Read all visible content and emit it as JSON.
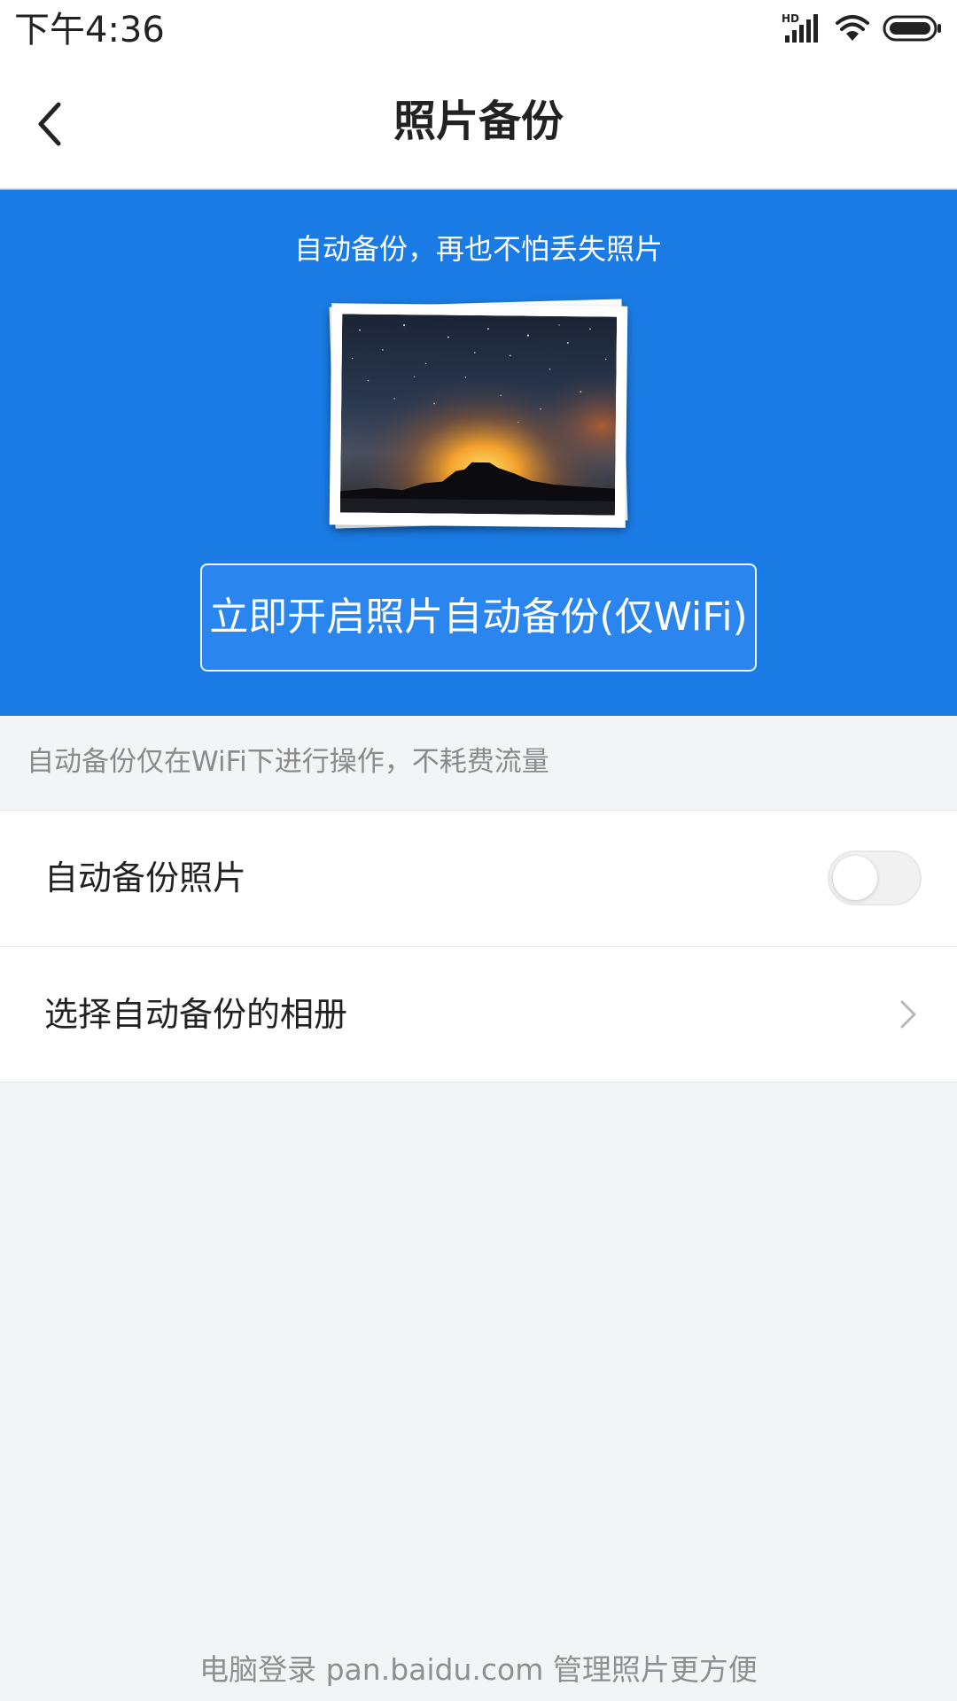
{
  "status_bar": {
    "time": "下午4:36",
    "icons": [
      "hd-signal-icon",
      "wifi-icon",
      "battery-icon"
    ]
  },
  "header": {
    "title": "照片备份",
    "back_icon": "chevron-left-icon"
  },
  "banner": {
    "tagline": "自动备份，再也不怕丢失照片",
    "image": "starry-night-photo",
    "enable_button_label": "立即开启照片自动备份(仅WiFi)",
    "background_color": "#1b7be4"
  },
  "notice": {
    "text": "自动备份仅在WiFi下进行操作，不耗费流量"
  },
  "settings": {
    "items": [
      {
        "label": "自动备份照片",
        "control": "toggle",
        "enabled": false
      },
      {
        "label": "选择自动备份的相册",
        "control": "chevron-right-icon"
      }
    ]
  },
  "footer": {
    "text": "电脑登录 pan.baidu.com 管理照片更方便"
  }
}
